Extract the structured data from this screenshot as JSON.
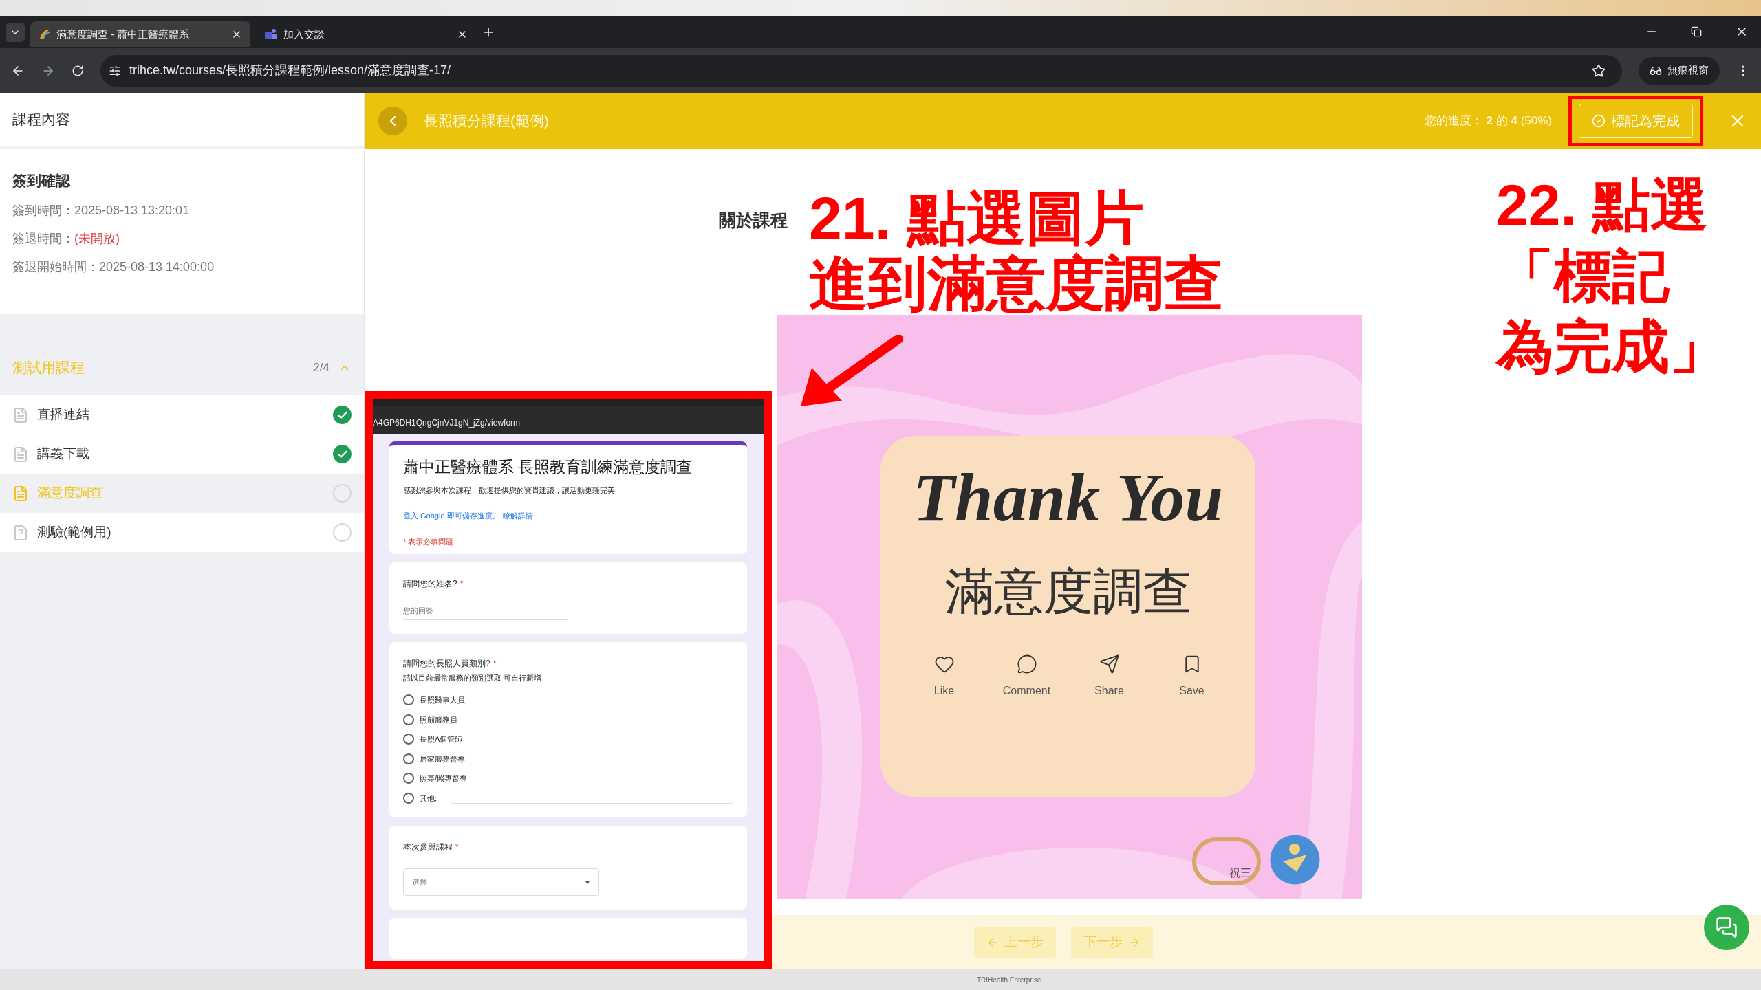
{
  "browser": {
    "tabs": [
      {
        "title": "滿意度調查 - 蕭中正醫療體系",
        "kind": "site",
        "selected": true
      },
      {
        "title": "加入交談",
        "kind": "chat",
        "selected": false
      }
    ],
    "url": "trihce.tw/courses/長照積分課程範例/lesson/滿意度調查-17/",
    "profile": "無痕視窗"
  },
  "header": {
    "course": "長照積分課程(範例)",
    "progress": "您的進度： **2** 的 **4** (50%)",
    "mark_complete": "標記為完成"
  },
  "sidebar": {
    "title": "課程內容",
    "checkin": {
      "title": "簽到確認",
      "rows": [
        {
          "label": "簽到時間：",
          "value": "2025-08-13 13:20:01",
          "alert": false
        },
        {
          "label": "簽退時間：",
          "value": "(未開放)",
          "alert": true
        },
        {
          "label": "簽退開始時間：",
          "value": "2025-08-13 14:00:00",
          "alert": false
        }
      ]
    },
    "section": {
      "title": "測試用課程",
      "count": "2/4",
      "expanded": true,
      "items": [
        {
          "label": "直播連結",
          "kind": "document",
          "completed": true,
          "selected": false
        },
        {
          "label": "講義下載",
          "kind": "document",
          "completed": true,
          "selected": false
        },
        {
          "label": "滿意度調查",
          "kind": "document",
          "completed": false,
          "selected": true
        },
        {
          "label": "測驗(範例用)",
          "kind": "quiz",
          "completed": false,
          "selected": false
        }
      ]
    }
  },
  "content": {
    "heading": "關於課程",
    "image": {
      "script": "Thank You",
      "title": "滿意度調查",
      "logo_text": "祝三",
      "actions": [
        {
          "label": "Like",
          "kind": "like"
        },
        {
          "label": "Comment",
          "kind": "comment"
        },
        {
          "label": "Share",
          "kind": "share"
        },
        {
          "label": "Save",
          "kind": "save"
        }
      ]
    }
  },
  "form_inset": {
    "url": "A4GP6DH1QngCjnVJ1gN_jZg/viewform",
    "title": "蕭中正醫療體系 長照教育訓練滿意度調查",
    "description": "感謝您參與本次課程，歡迎提供您的寶貴建議，讓活動更臻完美",
    "signin": "登入 Google 即可儲存進度。",
    "learn_more": "瞭解詳情",
    "required_note": "* 表示必填問題",
    "questions": [
      {
        "kind": "text",
        "title": "請問您的姓名?",
        "mark": "*",
        "placeholder": "您的回答"
      },
      {
        "kind": "radio",
        "title": "請問您的長照人員類別?",
        "mark": "*",
        "hint": "請以目前最常服務的類別選取 可自行新增",
        "options": [
          {
            "label": "長照醫事人員",
            "kind": "option",
            "selected": false
          },
          {
            "label": "照顧服務員",
            "kind": "option",
            "selected": false
          },
          {
            "label": "長照A個管師",
            "kind": "option",
            "selected": false
          },
          {
            "label": "居家服務督導",
            "kind": "option",
            "selected": false
          },
          {
            "label": "照專/照專督導",
            "kind": "option",
            "selected": false
          },
          {
            "label": "其他:",
            "kind": "other",
            "selected": false
          }
        ]
      },
      {
        "kind": "dropdown",
        "title": "本次參與課程",
        "mark": "*",
        "placeholder": "選擇"
      }
    ]
  },
  "annotations": [
    {
      "kind": "step",
      "lines": [
        "21. 點選圖片",
        "進到滿意度調查"
      ]
    },
    {
      "kind": "step",
      "lines": [
        "22. 點選",
        "「標記",
        "為完成」"
      ]
    }
  ],
  "nav": [
    {
      "label": "上一步",
      "kind": "prev",
      "disabled": true
    },
    {
      "label": "下一步",
      "kind": "next",
      "disabled": true
    }
  ],
  "desktop": {
    "caption": "TRIHealth Enterprise"
  }
}
